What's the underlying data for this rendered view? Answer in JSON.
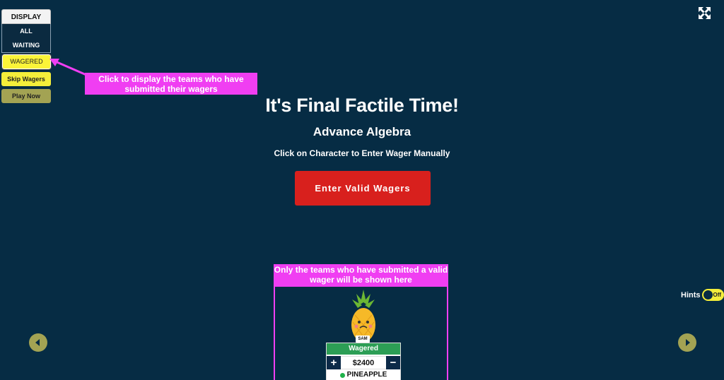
{
  "display_panel": {
    "header": "DISPLAY",
    "options": [
      "ALL",
      "WAITING"
    ],
    "wagered_label": "WAGERED",
    "skip_label": "Skip Wagers",
    "play_label": "Play Now"
  },
  "callouts": {
    "wagered_hint": "Click to display the teams who have submitted their wagers",
    "wager_area_hint": "Only the teams who have submitted a valid wager will be shown here"
  },
  "main": {
    "title": "It's Final Factile Time!",
    "subtitle": "Advance Algebra",
    "instruction": "Click on Character to Enter Wager Manually",
    "enter_button": "Enter Valid Wagers"
  },
  "team_card": {
    "tag": "SAM",
    "status": "Wagered",
    "amount": "$2400",
    "name": "PINEAPPLE",
    "plus": "+",
    "minus": "−"
  },
  "hints": {
    "label": "Hints",
    "state": "Off"
  },
  "icons": {
    "fullscreen": "fullscreen-icon",
    "nav_left": "arrow-left-icon",
    "nav_right": "arrow-right-icon"
  },
  "colors": {
    "background": "#062c44",
    "accent_yellow": "#f4ee3a",
    "button_red": "#d8201d",
    "callout_magenta": "#f03ef2",
    "status_green": "#2c9e55",
    "olive": "#a3a353"
  }
}
